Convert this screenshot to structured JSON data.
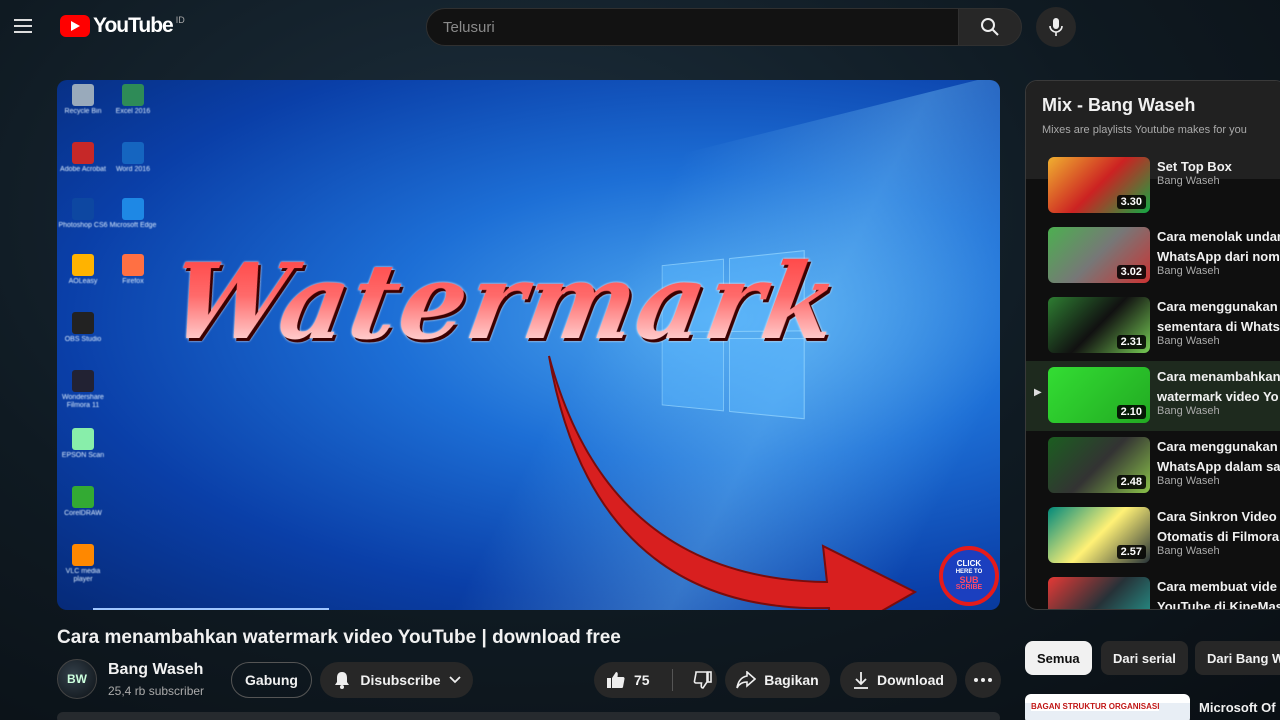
{
  "header": {
    "logo_text": "YouTube",
    "region": "ID",
    "search_placeholder": "Telusuri"
  },
  "player": {
    "overlay_text": "Watermark",
    "badge": {
      "line1": "CLICK",
      "line2": "HERE TO",
      "line3": "SUB",
      "line4": "SCRIBE"
    },
    "desktop_icons": [
      "Recycle Bin",
      "Excel 2016",
      "Adobe Acrobat",
      "Word 2016",
      "Photoshop CS6",
      "Microsoft Edge",
      "AOLeasy",
      "Firefox",
      "OBS Studio",
      "Wondershare Filmora 11",
      "EPSON Scan",
      "CorelDRAW",
      "VLC media player"
    ]
  },
  "video": {
    "title": "Cara menambahkan watermark video YouTube | download free",
    "channel": "Bang Waseh",
    "avatar_text": "BW",
    "subscribers": "25,4 rb subscriber",
    "join_label": "Gabung",
    "subscribe_label": "Disubscribe",
    "likes": "75",
    "share_label": "Bagikan",
    "download_label": "Download"
  },
  "mix": {
    "title": "Mix - Bang Waseh",
    "subtitle": "Mixes are playlists Youtube makes for you",
    "items": [
      {
        "title": "Set Top Box",
        "channel": "Bang Waseh",
        "duration": "3.30",
        "active": false
      },
      {
        "title": "Cara menolak undan\nWhatsApp dari nom",
        "channel": "Bang Waseh",
        "duration": "3.02",
        "active": false
      },
      {
        "title": "Cara menggunakan\nsementara di Whats",
        "channel": "Bang Waseh",
        "duration": "2.31",
        "active": false
      },
      {
        "title": "Cara menambahkan\nwatermark video Yo",
        "channel": "Bang Waseh",
        "duration": "2.10",
        "active": true
      },
      {
        "title": "Cara menggunakan\nWhatsApp dalam sa",
        "channel": "Bang Waseh",
        "duration": "2.48",
        "active": false
      },
      {
        "title": "Cara Sinkron Video\nOtomatis di Filmora",
        "channel": "Bang Waseh",
        "duration": "2.57",
        "active": false
      },
      {
        "title": "Cara membuat vide\nYouTube di KineMas",
        "channel": "",
        "duration": "",
        "active": false
      }
    ]
  },
  "chips": [
    "Semua",
    "Dari serial",
    "Dari Bang W"
  ],
  "recommendation": {
    "thumb_text": "BAGAN STRUKTUR ORGANISASI",
    "title": "Microsoft Of"
  },
  "colors": {
    "brand_red": "#ff0000",
    "overlay_red": "#e51b1b",
    "active_item_bg": "#1e2a1e"
  }
}
